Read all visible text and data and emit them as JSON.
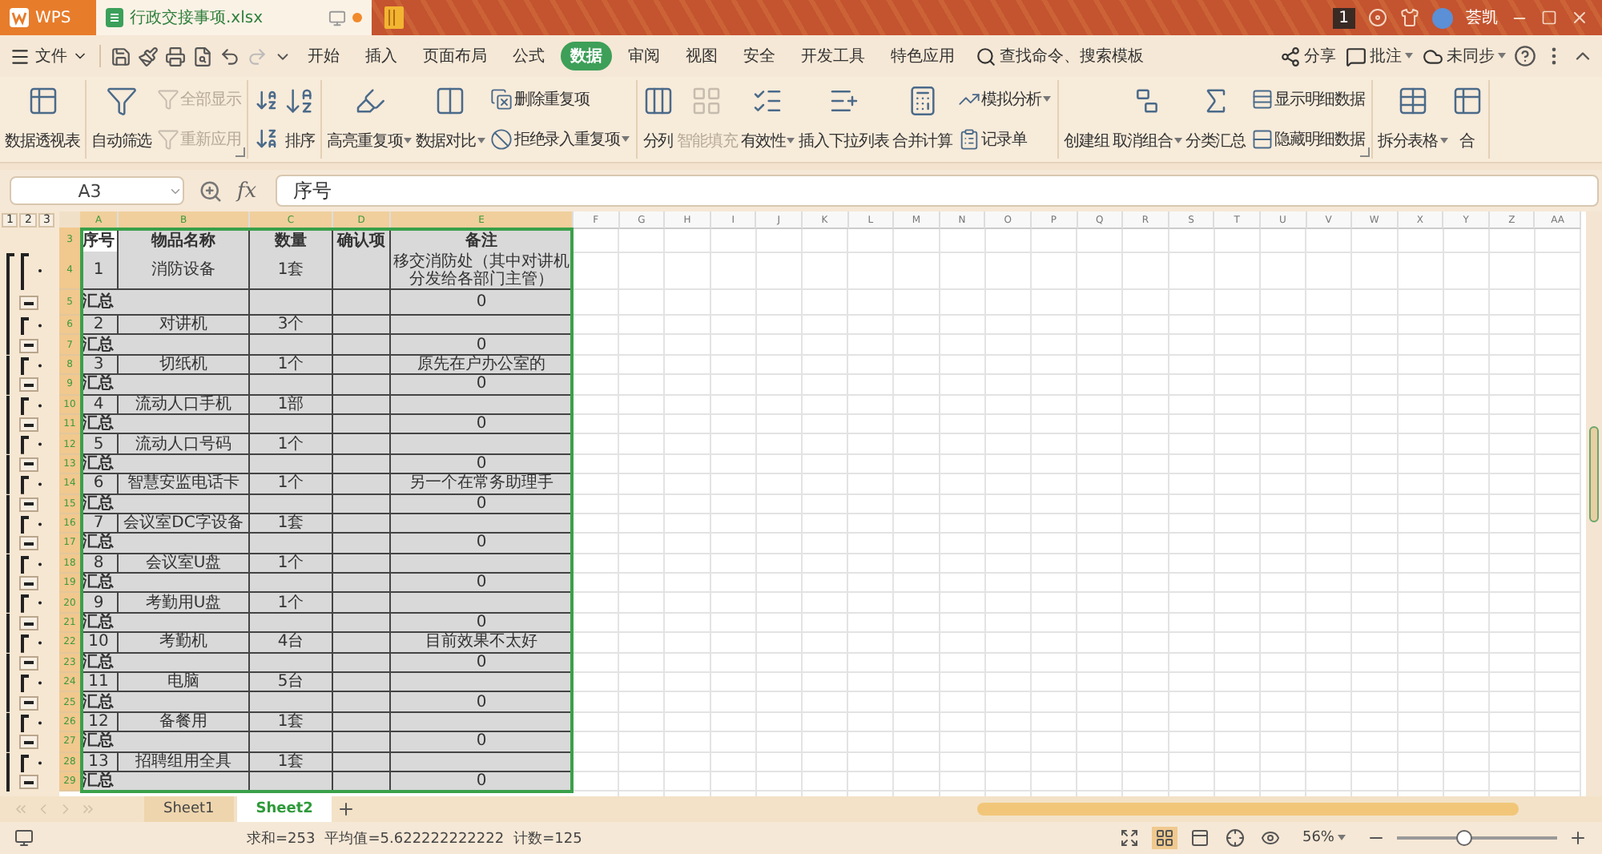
{
  "title_bar": {
    "app": "WPS",
    "document": "行政交接事项.xlsx",
    "badge": "1",
    "user": "荟凯"
  },
  "menu": {
    "file": "文件",
    "tabs": [
      {
        "label": "开始",
        "selected": false
      },
      {
        "label": "插入",
        "selected": false
      },
      {
        "label": "页面布局",
        "selected": false
      },
      {
        "label": "公式",
        "selected": false
      },
      {
        "label": "数据",
        "selected": true
      },
      {
        "label": "审阅",
        "selected": false
      },
      {
        "label": "视图",
        "selected": false
      },
      {
        "label": "安全",
        "selected": false
      },
      {
        "label": "开发工具",
        "selected": false
      },
      {
        "label": "特色应用",
        "selected": false
      }
    ],
    "search": "查找命令、搜索模板",
    "actions": [
      "分享",
      "批注",
      "未同步"
    ]
  },
  "ribbon": {
    "groups": [
      {
        "launcher": false,
        "columns": [
          {
            "kind": "large",
            "label": "数据透视表",
            "disabled": false,
            "dropdown": false
          }
        ]
      },
      {
        "launcher": true,
        "columns": [
          {
            "kind": "large",
            "label": "自动筛选",
            "disabled": false,
            "dropdown": false
          },
          {
            "kind": "stack",
            "items": [
              {
                "label": "全部显示",
                "disabled": true,
                "dropdown": false
              },
              {
                "label": "重新应用",
                "disabled": true,
                "dropdown": false
              }
            ]
          }
        ]
      },
      {
        "launcher": false,
        "columns": [
          {
            "kind": "icon_stack"
          },
          {
            "kind": "large",
            "label": "排序",
            "disabled": false,
            "dropdown": false
          }
        ]
      },
      {
        "launcher": false,
        "columns": [
          {
            "kind": "large",
            "label": "高亮重复项",
            "disabled": false,
            "dropdown": true
          },
          {
            "kind": "large",
            "label": "数据对比",
            "disabled": false,
            "dropdown": true
          },
          {
            "kind": "stack",
            "items": [
              {
                "label": "删除重复项",
                "disabled": false,
                "dropdown": false
              },
              {
                "label": "拒绝录入重复项",
                "disabled": false,
                "dropdown": true
              }
            ]
          }
        ]
      },
      {
        "launcher": false,
        "columns": [
          {
            "kind": "large",
            "label": "分列",
            "disabled": false,
            "dropdown": false
          },
          {
            "kind": "large",
            "label": "智能填充",
            "disabled": true,
            "dropdown": false
          },
          {
            "kind": "large",
            "label": "有效性",
            "disabled": false,
            "dropdown": true
          },
          {
            "kind": "large",
            "label": "插入下拉列表",
            "disabled": false,
            "dropdown": false
          },
          {
            "kind": "large",
            "label": "合并计算",
            "disabled": false,
            "dropdown": false
          },
          {
            "kind": "stack",
            "items": [
              {
                "label": "模拟分析",
                "disabled": false,
                "dropdown": true
              },
              {
                "label": "记录单",
                "disabled": false,
                "dropdown": false
              }
            ]
          }
        ]
      },
      {
        "launcher": true,
        "columns": [
          {
            "kind": "large",
            "label": "创建组",
            "disabled": false,
            "dropdown": false
          },
          {
            "kind": "large",
            "label": "取消组合",
            "disabled": false,
            "dropdown": true
          },
          {
            "kind": "large",
            "label": "分类汇总",
            "disabled": false,
            "dropdown": false
          },
          {
            "kind": "stack",
            "items": [
              {
                "label": "显示明细数据",
                "disabled": false,
                "dropdown": false
              },
              {
                "label": "隐藏明细数据",
                "disabled": false,
                "dropdown": false
              }
            ]
          }
        ]
      },
      {
        "launcher": false,
        "columns": [
          {
            "kind": "large",
            "label": "拆分表格",
            "disabled": false,
            "dropdown": true
          },
          {
            "kind": "large",
            "label": "合",
            "disabled": false,
            "dropdown": false
          }
        ]
      }
    ]
  },
  "formula_bar": {
    "name_box": "A3",
    "fx_label": "fx",
    "formula": "序号"
  },
  "sheet": {
    "outline_levels": [
      "1",
      "2",
      "3"
    ],
    "columns": [
      "A",
      "B",
      "C",
      "D",
      "E",
      "F",
      "G",
      "H",
      "I",
      "J",
      "K",
      "L",
      "M",
      "N",
      "O",
      "P",
      "Q",
      "R",
      "S",
      "T",
      "U",
      "V",
      "W",
      "X",
      "Y",
      "Z",
      "AA"
    ],
    "rows": [
      {
        "number": "3",
        "kind": "header",
        "seq": "序号",
        "name": "物品名称",
        "qty": "数量",
        "check": "确认项",
        "note": "备注"
      },
      {
        "number": "4",
        "kind": "item",
        "seq": "1",
        "name": "消防设备",
        "qty": "1套",
        "note": "移交消防处（其中对讲机分发给各部门主管）"
      },
      {
        "number": "5",
        "kind": "subtotal",
        "label": "汇总",
        "note": "0"
      },
      {
        "number": "6",
        "kind": "item",
        "seq": "2",
        "name": "对讲机",
        "qty": "3个"
      },
      {
        "number": "7",
        "kind": "subtotal",
        "label": "汇总",
        "note": "0"
      },
      {
        "number": "8",
        "kind": "item",
        "seq": "3",
        "name": "切纸机",
        "qty": "1个",
        "note": "原先在户办公室的"
      },
      {
        "number": "9",
        "kind": "subtotal",
        "label": "汇总",
        "note": "0"
      },
      {
        "number": "10",
        "kind": "item",
        "seq": "4",
        "name": "流动人口手机",
        "qty": "1部"
      },
      {
        "number": "11",
        "kind": "subtotal",
        "label": "汇总",
        "note": "0"
      },
      {
        "number": "12",
        "kind": "item",
        "seq": "5",
        "name": "流动人口号码",
        "qty": "1个"
      },
      {
        "number": "13",
        "kind": "subtotal",
        "label": "汇总",
        "note": "0"
      },
      {
        "number": "14",
        "kind": "item",
        "seq": "6",
        "name": "智慧安监电话卡",
        "qty": "1个",
        "note": "另一个在常务助理手"
      },
      {
        "number": "15",
        "kind": "subtotal",
        "label": "汇总",
        "note": "0"
      },
      {
        "number": "16",
        "kind": "item",
        "seq": "7",
        "name": "会议室DC字设备",
        "qty": "1套"
      },
      {
        "number": "17",
        "kind": "subtotal",
        "label": "汇总",
        "note": "0"
      },
      {
        "number": "18",
        "kind": "item",
        "seq": "8",
        "name": "会议室U盘",
        "qty": "1个"
      },
      {
        "number": "19",
        "kind": "subtotal",
        "label": "汇总",
        "note": "0"
      },
      {
        "number": "20",
        "kind": "item",
        "seq": "9",
        "name": "考勤用U盘",
        "qty": "1个"
      },
      {
        "number": "21",
        "kind": "subtotal",
        "label": "汇总",
        "note": "0"
      },
      {
        "number": "22",
        "kind": "item",
        "seq": "10",
        "name": "考勤机",
        "qty": "4台",
        "note": "目前效果不太好"
      },
      {
        "number": "23",
        "kind": "subtotal",
        "label": "汇总",
        "note": "0"
      },
      {
        "number": "24",
        "kind": "item",
        "seq": "11",
        "name": "电脑",
        "qty": "5台"
      },
      {
        "number": "25",
        "kind": "subtotal",
        "label": "汇总",
        "note": "0"
      },
      {
        "number": "26",
        "kind": "item",
        "seq": "12",
        "name": "备餐用",
        "qty": "1套"
      },
      {
        "number": "27",
        "kind": "subtotal",
        "label": "汇总",
        "note": "0"
      },
      {
        "number": "28",
        "kind": "item",
        "seq": "13",
        "name": "招聘组用全具",
        "qty": "1套"
      },
      {
        "number": "29",
        "kind": "subtotal",
        "label": "汇总",
        "note": "0"
      }
    ]
  },
  "sheet_tabs": [
    {
      "label": "Sheet1",
      "selected": false
    },
    {
      "label": "Sheet2",
      "selected": true
    }
  ],
  "status_bar": {
    "stats": [
      "求和=253",
      "平均值=5.622222222222",
      "计数=125"
    ],
    "zoom": {
      "label": "56%",
      "level": 0.42
    }
  }
}
